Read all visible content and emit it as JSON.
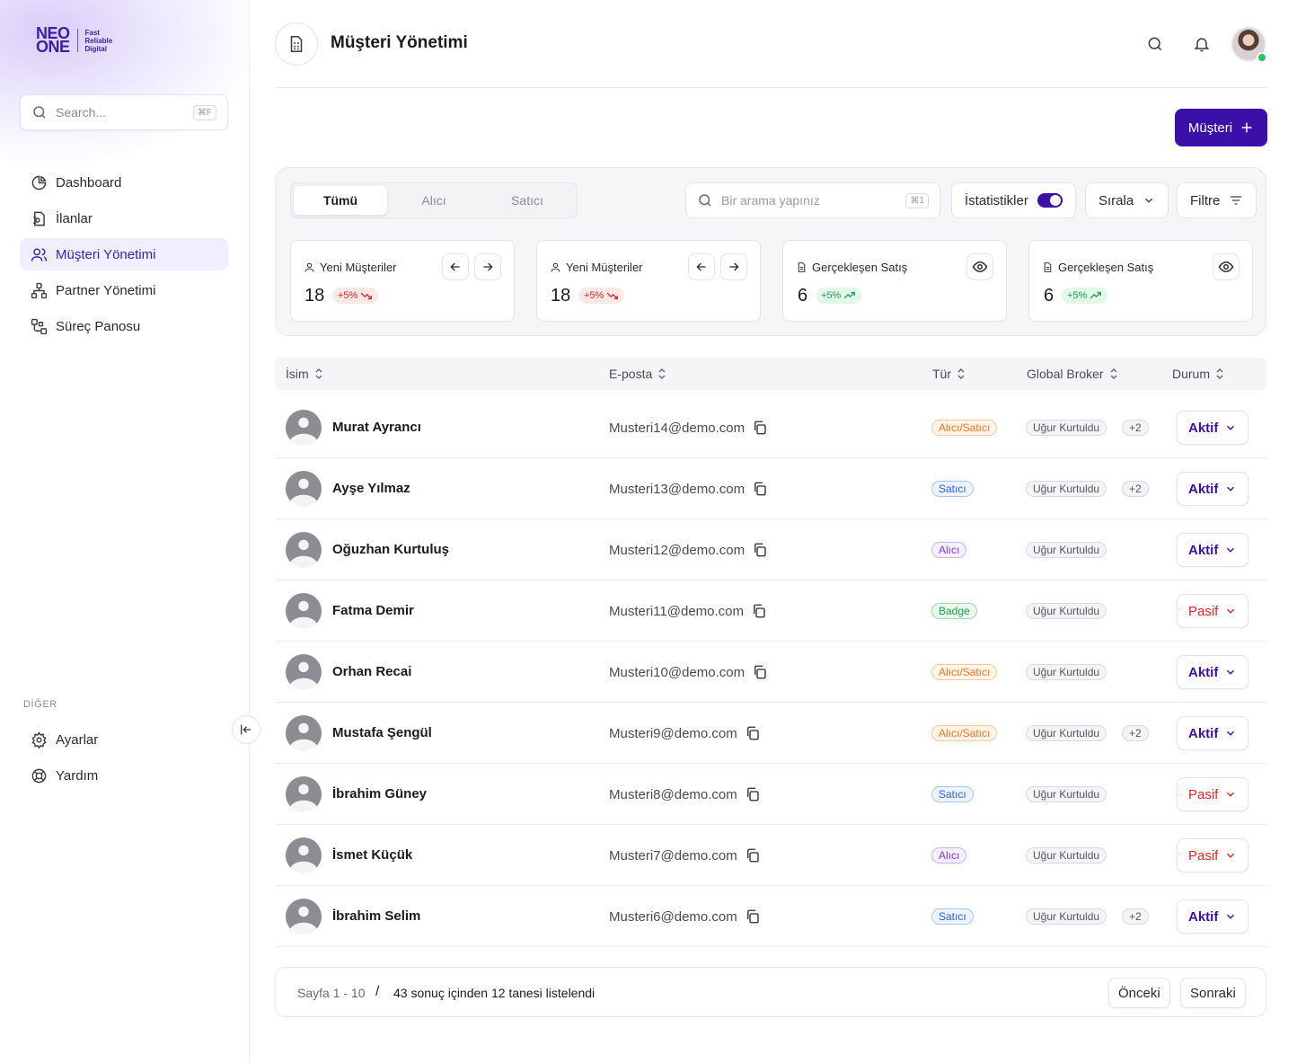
{
  "brand": {
    "word1": "NEO",
    "word2": "ONE",
    "tag1": "Fast",
    "tag2": "Reliable",
    "tag3": "Digital"
  },
  "sidebar": {
    "search_placeholder": "Search...",
    "search_shortcut": "⌘F",
    "items": [
      {
        "label": "Dashboard",
        "icon": "pie-chart-icon"
      },
      {
        "label": "İlanlar",
        "icon": "file-icon"
      },
      {
        "label": "Müşteri Yönetimi",
        "icon": "users-icon",
        "active": true
      },
      {
        "label": "Partner Yönetimi",
        "icon": "network-icon"
      },
      {
        "label": "Süreç Panosu",
        "icon": "flow-icon"
      }
    ],
    "section_other": "DİĞER",
    "other_items": [
      {
        "label": "Ayarlar",
        "icon": "gear-icon"
      },
      {
        "label": "Yardım",
        "icon": "lifebuoy-icon"
      }
    ]
  },
  "header": {
    "title": "Müşteri Yönetimi",
    "add_button": "Müşteri"
  },
  "filters": {
    "tabs": [
      "Tümü",
      "Alıcı",
      "Satıcı"
    ],
    "active_tab": "Tümü",
    "search_placeholder": "Bir arama yapınız",
    "search_shortcut": "⌘1",
    "stats_label": "İstatistikler",
    "stats_on": true,
    "sort_label": "Sırala",
    "filter_label": "Filtre"
  },
  "cards": [
    {
      "title": "Yeni Müşteriler",
      "value": "18",
      "trend": "+5%",
      "direction": "down"
    },
    {
      "title": "Yeni Müşteriler",
      "value": "18",
      "trend": "+5%",
      "direction": "down"
    },
    {
      "title": "Gerçekleşen Satış",
      "value": "6",
      "trend": "+5%",
      "direction": "up"
    },
    {
      "title": "Gerçekleşen Satış",
      "value": "6",
      "trend": "+5%",
      "direction": "up"
    }
  ],
  "table": {
    "columns": [
      "İsim",
      "E-posta",
      "Tür",
      "Global Broker",
      "Durum"
    ],
    "rows": [
      {
        "name": "Murat Ayrancı",
        "email": "Musteri14@demo.com",
        "type": "Alıcı/Satıcı",
        "type_style": "as",
        "broker": "Uğur Kurtuldu",
        "extra": "+2",
        "status": "Aktif"
      },
      {
        "name": "Ayşe Yılmaz",
        "email": "Musteri13@demo.com",
        "type": "Satıcı",
        "type_style": "s",
        "broker": "Uğur Kurtuldu",
        "extra": "+2",
        "status": "Aktif"
      },
      {
        "name": "Oğuzhan Kurtuluş",
        "email": "Musteri12@demo.com",
        "type": "Alıcı",
        "type_style": "a",
        "broker": "Uğur Kurtuldu",
        "extra": "",
        "status": "Aktif"
      },
      {
        "name": "Fatma Demir",
        "email": "Musteri11@demo.com",
        "type": "Badge",
        "type_style": "b",
        "broker": "Uğur Kurtuldu",
        "extra": "",
        "status": "Pasif"
      },
      {
        "name": "Orhan Recai",
        "email": "Musteri10@demo.com",
        "type": "Alıcı/Satıcı",
        "type_style": "as",
        "broker": "Uğur Kurtuldu",
        "extra": "",
        "status": "Aktif"
      },
      {
        "name": "Mustafa Şengül",
        "email": "Musteri9@demo.com",
        "type": "Alıcı/Satıcı",
        "type_style": "as",
        "broker": "Uğur Kurtuldu",
        "extra": "+2",
        "status": "Aktif"
      },
      {
        "name": "İbrahim Güney",
        "email": "Musteri8@demo.com",
        "type": "Satıcı",
        "type_style": "s",
        "broker": "Uğur Kurtuldu",
        "extra": "",
        "status": "Pasif"
      },
      {
        "name": "İsmet Küçük",
        "email": "Musteri7@demo.com",
        "type": "Alıcı",
        "type_style": "a",
        "broker": "Uğur Kurtuldu",
        "extra": "",
        "status": "Pasif"
      },
      {
        "name": "İbrahim Selim",
        "email": "Musteri6@demo.com",
        "type": "Satıcı",
        "type_style": "s",
        "broker": "Uğur Kurtuldu",
        "extra": "+2",
        "status": "Aktif"
      }
    ]
  },
  "pagination": {
    "range": "Sayfa 1 - 10",
    "separator": "/",
    "summary": "43 sonuç içinden 12 tanesi listelendi",
    "prev": "Önceki",
    "next": "Sonraki"
  },
  "colors": {
    "accent": "#3b10a8",
    "danger": "#e02424",
    "success": "#16a34a",
    "online": "#22c55e"
  }
}
